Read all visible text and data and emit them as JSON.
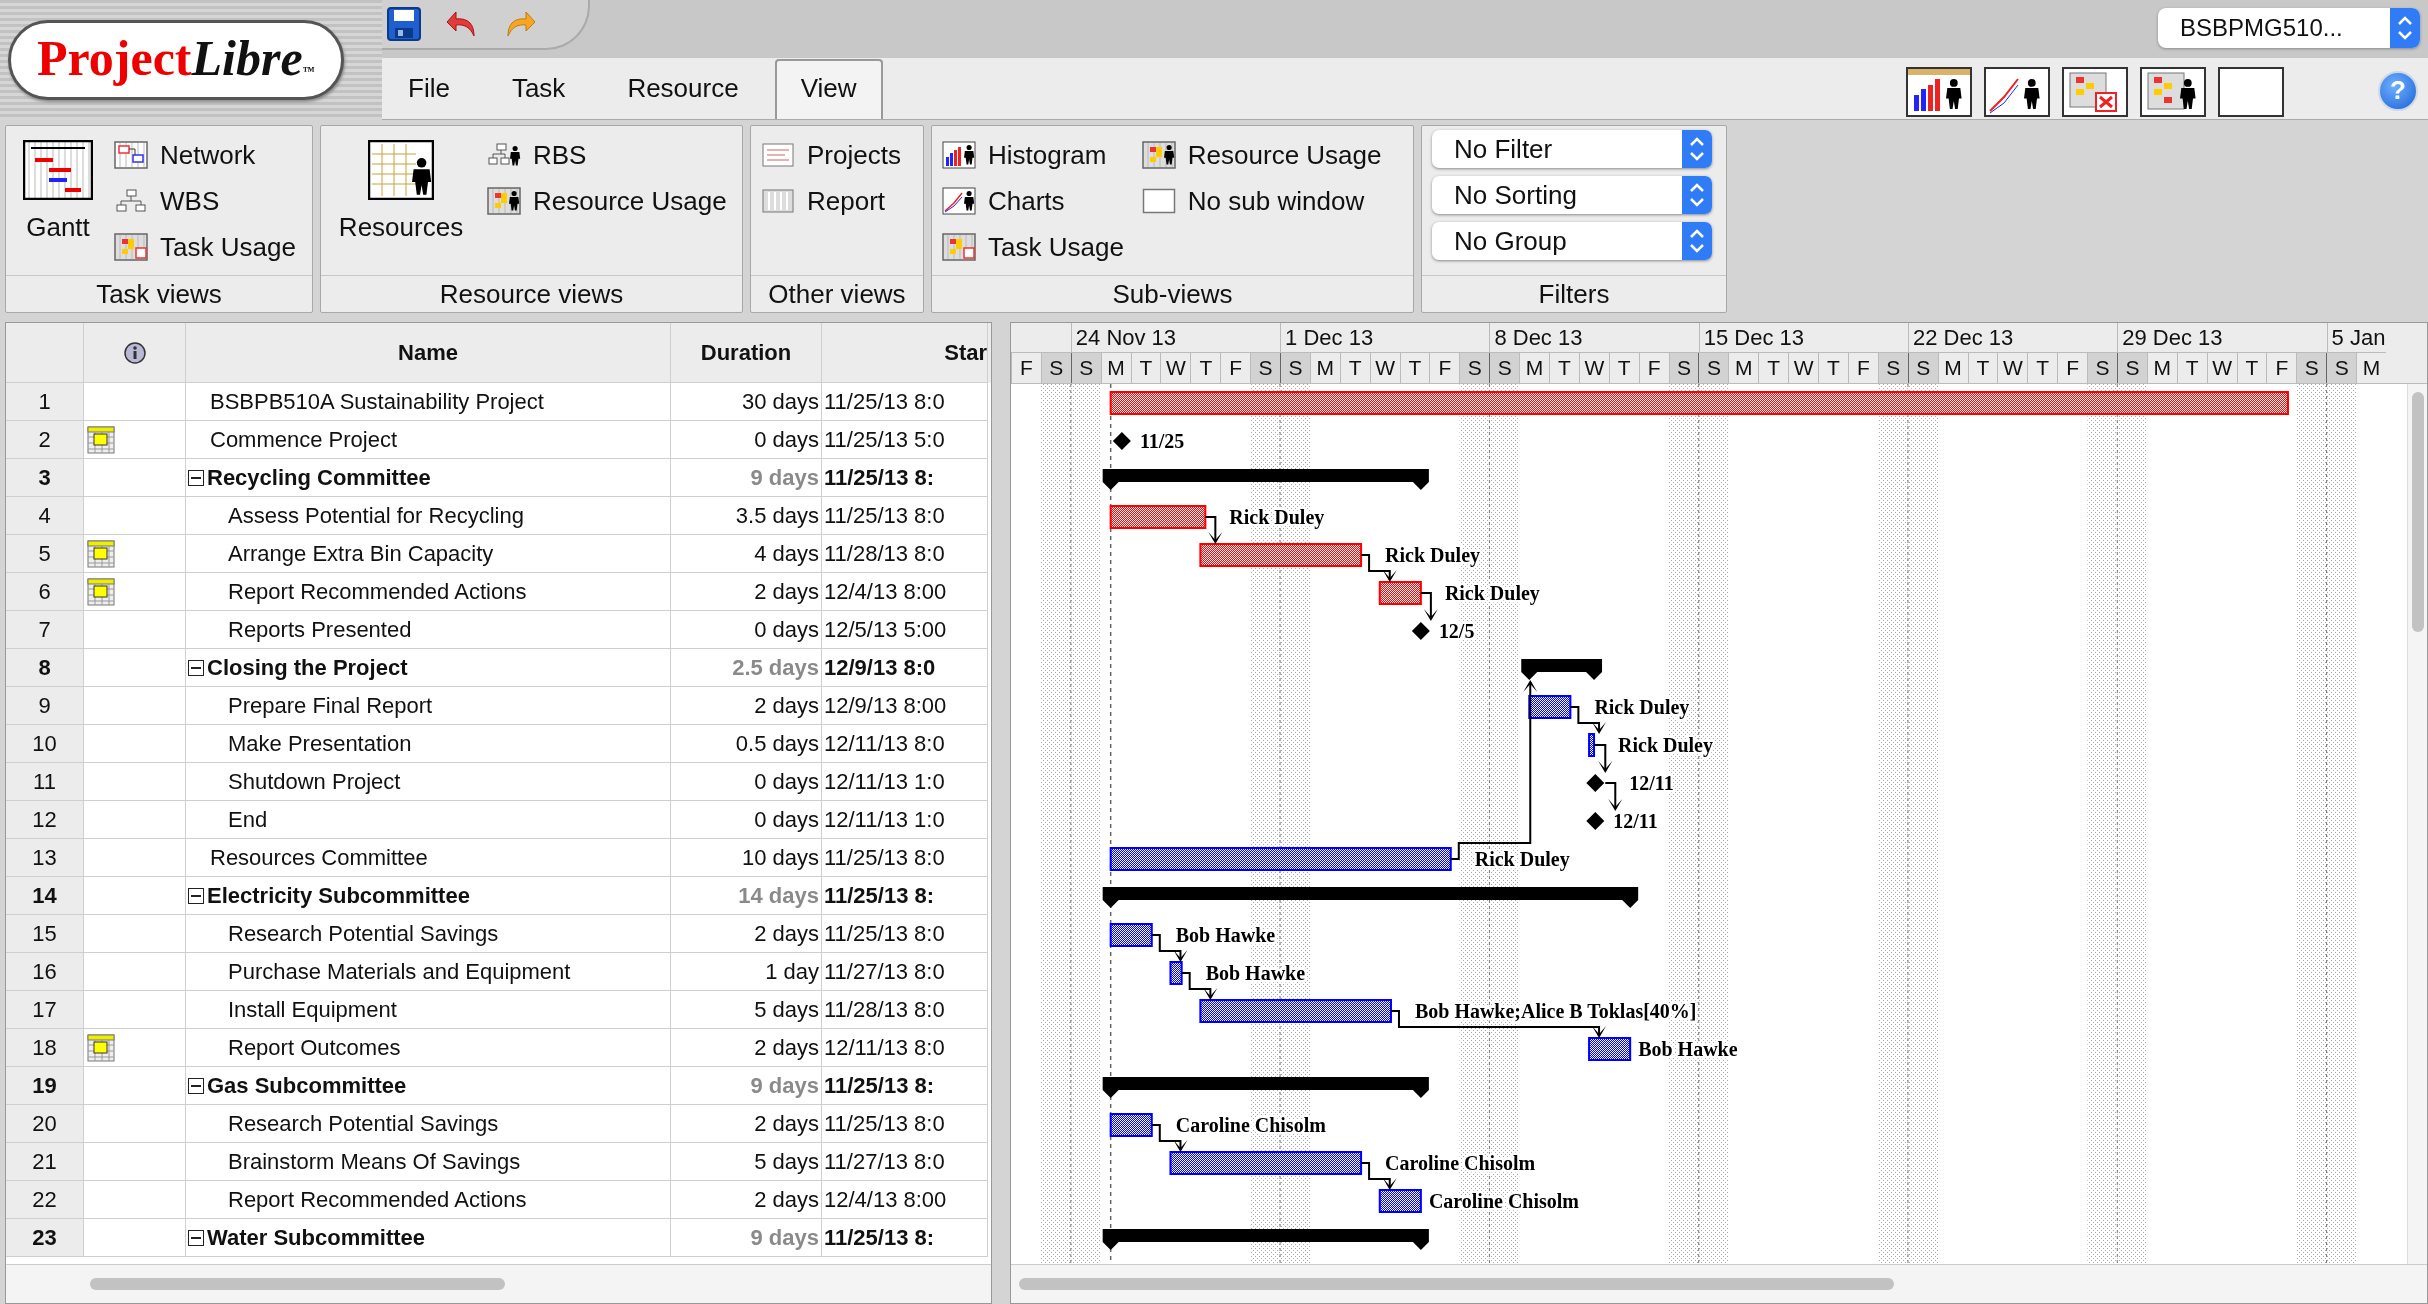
{
  "logo": {
    "primary": "Project",
    "secondary": "Libre",
    "mark": "™"
  },
  "project_selector": {
    "value": "BSBPMG510..."
  },
  "menu_tabs": [
    {
      "label": "File",
      "selected": false
    },
    {
      "label": "Task",
      "selected": false
    },
    {
      "label": "Resource",
      "selected": false
    },
    {
      "label": "View",
      "selected": true
    }
  ],
  "help_button": {
    "label": "?"
  },
  "ribbon_groups": [
    {
      "title": "Task views",
      "columns": [
        [
          {
            "label": "Gantt",
            "kind": "large"
          }
        ],
        [
          {
            "label": "Network",
            "kind": "small"
          },
          {
            "label": "WBS",
            "kind": "small"
          },
          {
            "label": "Task Usage",
            "kind": "small"
          }
        ]
      ]
    },
    {
      "title": "Resource views",
      "columns": [
        [
          {
            "label": "Resources",
            "kind": "large"
          }
        ],
        [
          {
            "label": "RBS",
            "kind": "small"
          },
          {
            "label": "Resource Usage",
            "kind": "small"
          }
        ]
      ]
    },
    {
      "title": "Other views",
      "columns": [
        [
          {
            "label": "Projects",
            "kind": "small"
          },
          {
            "label": "Report",
            "kind": "small"
          }
        ]
      ]
    },
    {
      "title": "Sub-views",
      "columns": [
        [
          {
            "label": "Histogram",
            "kind": "small"
          },
          {
            "label": "Charts",
            "kind": "small"
          },
          {
            "label": "Task Usage",
            "kind": "small"
          }
        ],
        [
          {
            "label": "Resource Usage",
            "kind": "small"
          },
          {
            "label": "No sub window",
            "kind": "small"
          }
        ]
      ]
    },
    {
      "title": "Filters",
      "columns": [
        [
          {
            "label": "No Filter",
            "kind": "dropdown"
          },
          {
            "label": "No Sorting",
            "kind": "dropdown"
          },
          {
            "label": "No Group",
            "kind": "dropdown"
          }
        ]
      ]
    }
  ],
  "table": {
    "columns": [
      "Name",
      "Duration",
      "Star"
    ],
    "rows": [
      {
        "number": "1",
        "indicator": false,
        "kind": "task",
        "name": "BSBPB510A Sustainability Project",
        "duration": "30 days",
        "start": "11/25/13 8:0",
        "bar": {
          "kind": "task",
          "color": "#ff0000",
          "link_in": false,
          "link_out": false
        }
      },
      {
        "number": "2",
        "indicator": true,
        "kind": "task",
        "name": "Commence Project",
        "duration": "0 days",
        "start": "11/25/13 5:0",
        "bar": {
          "kind": "milestone",
          "label": "11/25",
          "link_in": false,
          "link_out": false
        }
      },
      {
        "number": "3",
        "indicator": false,
        "kind": "summary",
        "expanded": true,
        "name": "Recycling Committee",
        "duration": "9 days",
        "start": "11/25/13 8:",
        "bar": {
          "kind": "summary",
          "link_in": false,
          "link_out": false
        },
        "children": [
          {
            "number": "4",
            "indicator": false,
            "kind": "task",
            "name": "Assess Potential for Recycling",
            "duration": "3.5 days",
            "start": "11/25/13 8:0",
            "bar": {
              "kind": "task",
              "color": "#ff0000",
              "label": "Rick Duley",
              "link_in": false,
              "link_out": false
            }
          },
          {
            "number": "5",
            "indicator": true,
            "kind": "task",
            "name": "Arrange Extra Bin Capacity",
            "duration": "4 days",
            "start": "11/28/13 8:0",
            "bar": {
              "kind": "task",
              "color": "#ff0000",
              "label": "Rick Duley",
              "link_in": true,
              "link_out": false
            }
          },
          {
            "number": "6",
            "indicator": true,
            "kind": "task",
            "name": "Report Recommended Actions",
            "duration": "2 days",
            "start": "12/4/13 8:00",
            "bar": {
              "kind": "task",
              "color": "#ff0000",
              "label": "Rick Duley",
              "link_in": true,
              "link_out": false
            }
          },
          {
            "number": "7",
            "indicator": false,
            "kind": "task",
            "name": "Reports Presented",
            "duration": "0 days",
            "start": "12/5/13 5:00",
            "bar": {
              "kind": "milestone",
              "label": "12/5",
              "link_in": true,
              "link_out": false
            }
          }
        ]
      },
      {
        "number": "8",
        "indicator": false,
        "kind": "summary",
        "expanded": true,
        "name": "Closing the Project",
        "duration": "2.5 days",
        "start": "12/9/13 8:0",
        "bar": {
          "kind": "summary",
          "link_in": false,
          "link_out": false
        },
        "children": [
          {
            "number": "9",
            "indicator": false,
            "kind": "task",
            "name": "Prepare Final Report",
            "duration": "2 days",
            "start": "12/9/13 8:00",
            "bar": {
              "kind": "task",
              "color": "#0000ff",
              "label": "Rick Duley",
              "link_in": false,
              "link_out": false
            }
          },
          {
            "number": "10",
            "indicator": false,
            "kind": "task",
            "name": "Make Presentation",
            "duration": "0.5 days",
            "start": "12/11/13 8:0",
            "bar": {
              "kind": "task",
              "color": "#0000ff",
              "label": "Rick Duley",
              "link_in": true,
              "link_out": false
            }
          },
          {
            "number": "11",
            "indicator": false,
            "kind": "task",
            "name": "Shutdown Project",
            "duration": "0 days",
            "start": "12/11/13 1:0",
            "bar": {
              "kind": "milestone",
              "label": "12/11",
              "link_in": true,
              "link_out": false
            }
          },
          {
            "number": "12",
            "indicator": false,
            "kind": "task",
            "name": "End",
            "duration": "0 days",
            "start": "12/11/13 1:0",
            "bar": {
              "kind": "milestone",
              "label": "12/11",
              "link_in": true,
              "link_out": false
            }
          }
        ]
      },
      {
        "number": "13",
        "indicator": false,
        "kind": "task",
        "name": "Resources Committee",
        "duration": "10 days",
        "start": "11/25/13 8:0",
        "bar": {
          "kind": "task",
          "color": "#0000ff",
          "label": "Rick Duley",
          "link_in": false,
          "link_out": true
        }
      },
      {
        "number": "14",
        "indicator": false,
        "kind": "summary",
        "expanded": true,
        "name": "Electricity Subcommittee",
        "duration": "14 days",
        "start": "11/25/13 8:",
        "bar": {
          "kind": "summary",
          "link_in": false,
          "link_out": false
        },
        "children": [
          {
            "number": "15",
            "indicator": false,
            "kind": "task",
            "name": "Research Potential Savings",
            "duration": "2 days",
            "start": "11/25/13 8:0",
            "bar": {
              "kind": "task",
              "color": "#0000ff",
              "label": "Bob Hawke",
              "link_in": false,
              "link_out": false
            }
          },
          {
            "number": "16",
            "indicator": false,
            "kind": "task",
            "name": "Purchase Materials and Equipment",
            "duration": "1 day",
            "start": "11/27/13 8:0",
            "bar": {
              "kind": "task",
              "color": "#0000ff",
              "label": "Bob Hawke",
              "link_in": true,
              "link_out": false
            }
          },
          {
            "number": "17",
            "indicator": false,
            "kind": "task",
            "name": "Install Equipment",
            "duration": "5 days",
            "start": "11/28/13 8:0",
            "bar": {
              "kind": "task",
              "color": "#0000ff",
              "label": "Bob Hawke;Alice B Toklas[40%]",
              "link_in": true,
              "link_out": false
            }
          },
          {
            "number": "18",
            "indicator": true,
            "kind": "task",
            "name": "Report Outcomes",
            "duration": "2 days",
            "start": "12/11/13 8:0",
            "bar": {
              "kind": "task",
              "color": "#0000ff",
              "label": "Bob Hawke",
              "link_in": true,
              "link_out": false
            }
          }
        ]
      },
      {
        "number": "19",
        "indicator": false,
        "kind": "summary",
        "expanded": true,
        "name": "Gas Subcommittee",
        "duration": "9 days",
        "start": "11/25/13 8:",
        "bar": {
          "kind": "summary",
          "link_in": false,
          "link_out": false
        },
        "children": [
          {
            "number": "20",
            "indicator": false,
            "kind": "task",
            "name": "Research Potential Savings",
            "duration": "2 days",
            "start": "11/25/13 8:0",
            "bar": {
              "kind": "task",
              "color": "#0000ff",
              "label": "Caroline Chisolm",
              "link_in": false,
              "link_out": false
            }
          },
          {
            "number": "21",
            "indicator": false,
            "kind": "task",
            "name": "Brainstorm Means Of Savings",
            "duration": "5 days",
            "start": "11/27/13 8:0",
            "bar": {
              "kind": "task",
              "color": "#0000ff",
              "label": "Caroline Chisolm",
              "link_in": true,
              "link_out": false
            }
          },
          {
            "number": "22",
            "indicator": false,
            "kind": "task",
            "name": "Report Recommended Actions",
            "duration": "2 days",
            "start": "12/4/13 8:00",
            "bar": {
              "kind": "task",
              "color": "#0000ff",
              "label": "Caroline Chisolm",
              "link_in": true,
              "link_out": false
            }
          }
        ]
      },
      {
        "number": "23",
        "indicator": false,
        "kind": "summary",
        "expanded": true,
        "name": "Water Subcommittee",
        "duration": "9 days",
        "start": "11/25/13 8:",
        "bar": {
          "kind": "summary",
          "link_in": false,
          "link_out": false
        }
      }
    ]
  },
  "gantt": {
    "weeks": [
      "24 Nov 13",
      "1 Dec 13",
      "8 Dec 13",
      "15 Dec 13",
      "22 Dec 13",
      "29 Dec 13",
      "5 Jan"
    ],
    "days": [
      {
        "letter": "F",
        "weekend": false,
        "week_start": false
      },
      {
        "letter": "S",
        "weekend": true,
        "week_start": false
      },
      {
        "letter": "S",
        "weekend": true,
        "week_start": true
      },
      {
        "letter": "M",
        "weekend": false,
        "week_start": false
      },
      {
        "letter": "T",
        "weekend": false,
        "week_start": false
      },
      {
        "letter": "W",
        "weekend": false,
        "week_start": false
      },
      {
        "letter": "T",
        "weekend": false,
        "week_start": false
      },
      {
        "letter": "F",
        "weekend": false,
        "week_start": false
      },
      {
        "letter": "S",
        "weekend": true,
        "week_start": false
      },
      {
        "letter": "S",
        "weekend": true,
        "week_start": true
      },
      {
        "letter": "M",
        "weekend": false,
        "week_start": false
      },
      {
        "letter": "T",
        "weekend": false,
        "week_start": false
      },
      {
        "letter": "W",
        "weekend": false,
        "week_start": false
      },
      {
        "letter": "T",
        "weekend": false,
        "week_start": false
      },
      {
        "letter": "F",
        "weekend": false,
        "week_start": false
      },
      {
        "letter": "S",
        "weekend": true,
        "week_start": false
      },
      {
        "letter": "S",
        "weekend": true,
        "week_start": true
      },
      {
        "letter": "M",
        "weekend": false,
        "week_start": false
      },
      {
        "letter": "T",
        "weekend": false,
        "week_start": false
      },
      {
        "letter": "W",
        "weekend": false,
        "week_start": false
      },
      {
        "letter": "T",
        "weekend": false,
        "week_start": false
      },
      {
        "letter": "F",
        "weekend": false,
        "week_start": false
      },
      {
        "letter": "S",
        "weekend": true,
        "week_start": false
      },
      {
        "letter": "S",
        "weekend": true,
        "week_start": true
      },
      {
        "letter": "M",
        "weekend": false,
        "week_start": false
      },
      {
        "letter": "T",
        "weekend": false,
        "week_start": false
      },
      {
        "letter": "W",
        "weekend": false,
        "week_start": false
      },
      {
        "letter": "T",
        "weekend": false,
        "week_start": false
      },
      {
        "letter": "F",
        "weekend": false,
        "week_start": false
      },
      {
        "letter": "S",
        "weekend": true,
        "week_start": false
      },
      {
        "letter": "S",
        "weekend": true,
        "week_start": true
      },
      {
        "letter": "M",
        "weekend": false,
        "week_start": false
      },
      {
        "letter": "T",
        "weekend": false,
        "week_start": false
      },
      {
        "letter": "W",
        "weekend": false,
        "week_start": false
      },
      {
        "letter": "T",
        "weekend": false,
        "week_start": false
      },
      {
        "letter": "F",
        "weekend": false,
        "week_start": false
      },
      {
        "letter": "S",
        "weekend": true,
        "week_start": false
      },
      {
        "letter": "S",
        "weekend": true,
        "week_start": true
      },
      {
        "letter": "M",
        "weekend": false,
        "week_start": false
      },
      {
        "letter": "T",
        "weekend": false,
        "week_start": false
      },
      {
        "letter": "W",
        "weekend": false,
        "week_start": false
      },
      {
        "letter": "T",
        "weekend": false,
        "week_start": false
      },
      {
        "letter": "F",
        "weekend": false,
        "week_start": false
      },
      {
        "letter": "S",
        "weekend": true,
        "week_start": false
      },
      {
        "letter": "S",
        "weekend": true,
        "week_start": true
      },
      {
        "letter": "M",
        "weekend": false,
        "week_start": false
      }
    ]
  }
}
